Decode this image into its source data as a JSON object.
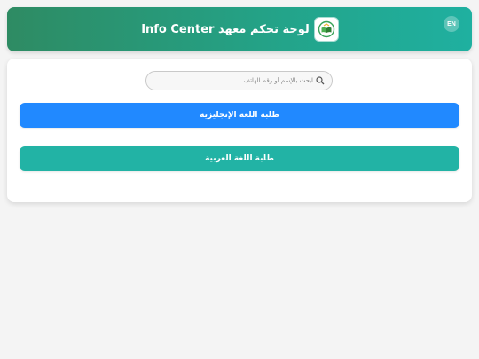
{
  "header": {
    "title": "لوحة تحكم معهد Info Center",
    "language_button": "EN",
    "logo_icon": "book-logo-icon"
  },
  "search": {
    "placeholder": "ابحث بالإسم أو رقم الهاتف..."
  },
  "buttons": {
    "english_students": "طلبة اللغة الإنجليزية",
    "arabic_students": "طلبة اللغة العربية"
  },
  "colors": {
    "header_start": "#2e8b63",
    "header_end": "#1fb0a0",
    "english_button": "#2189ff",
    "arabic_button": "#22b3a5",
    "background": "#f4f4f4"
  }
}
